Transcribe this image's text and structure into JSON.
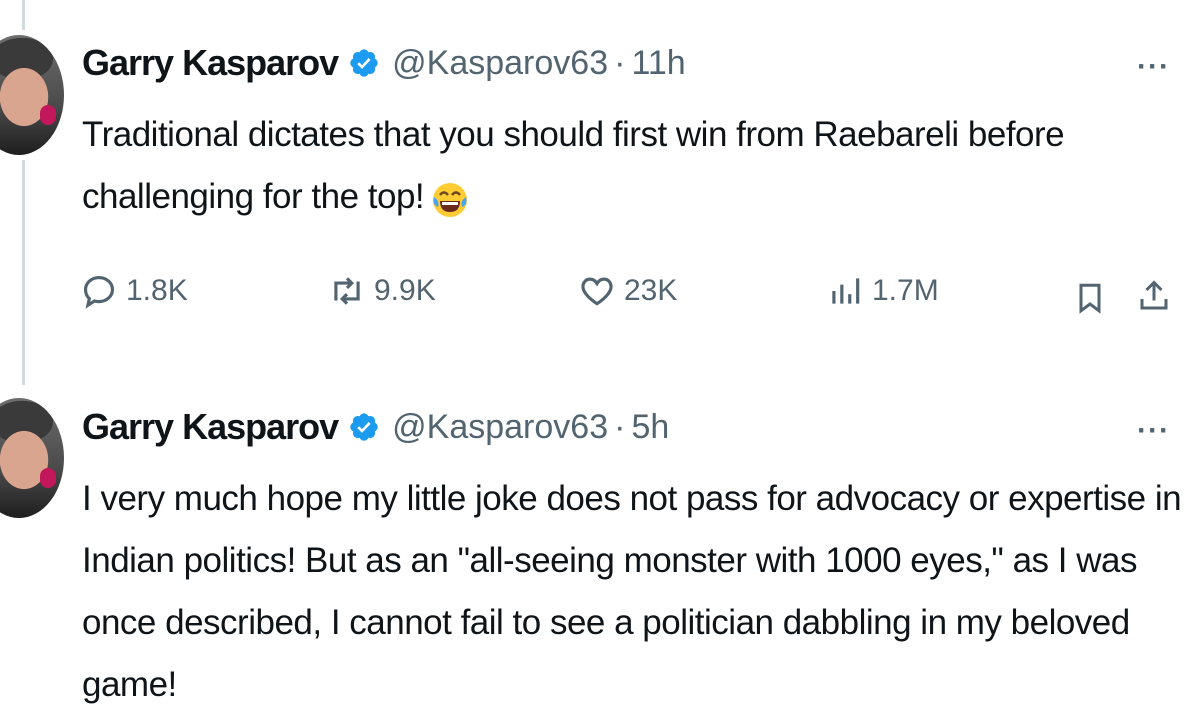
{
  "tweets": [
    {
      "name": "Garry Kasparov",
      "handle": "@Kasparov63",
      "separator": "·",
      "time": "11h",
      "text": "Traditional dictates that you should first win from Raebareli before challenging for the top!",
      "emoji": "face-with-tears-of-joy",
      "actions": {
        "replies": "1.8K",
        "reposts": "9.9K",
        "likes": "23K",
        "views": "1.7M"
      }
    },
    {
      "name": "Garry Kasparov",
      "handle": "@Kasparov63",
      "separator": "·",
      "time": "5h",
      "text": "I very much hope my little joke does not pass for advocacy or expertise in Indian politics! But as an \"all-seeing monster with 1000 eyes,\" as I was once described, I cannot fail to see a politician dabbling in my beloved game!"
    }
  ],
  "more_label": "···",
  "colors": {
    "verified": "#1d9bf0",
    "muted_text": "#536471",
    "thread_line": "#cfd9de"
  }
}
